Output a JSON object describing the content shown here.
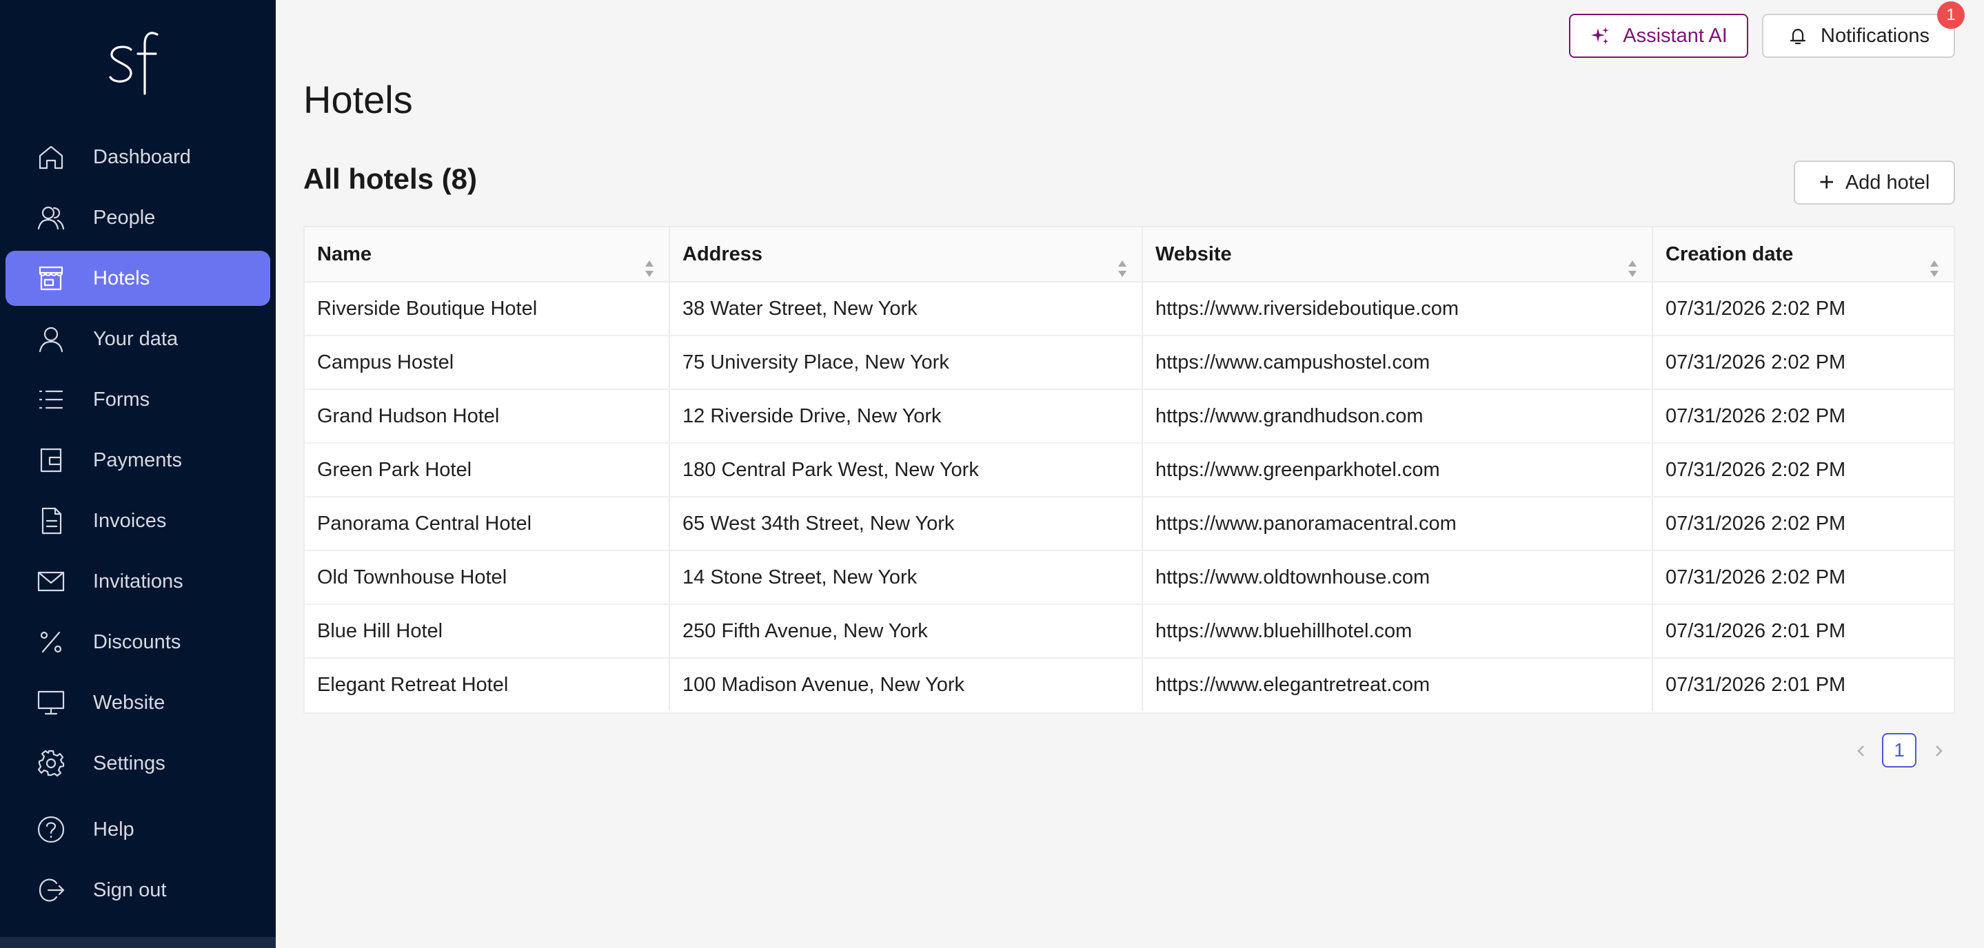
{
  "sidebar": {
    "logo_text": "sf",
    "items": [
      {
        "label": "Dashboard",
        "icon": "home-icon"
      },
      {
        "label": "People",
        "icon": "people-icon"
      },
      {
        "label": "Hotels",
        "icon": "storefront-icon",
        "active": true
      },
      {
        "label": "Your data",
        "icon": "user-icon"
      },
      {
        "label": "Forms",
        "icon": "list-icon"
      },
      {
        "label": "Payments",
        "icon": "wallet-icon"
      },
      {
        "label": "Invoices",
        "icon": "document-icon"
      },
      {
        "label": "Invitations",
        "icon": "mail-icon"
      },
      {
        "label": "Discounts",
        "icon": "percent-icon"
      },
      {
        "label": "Website",
        "icon": "monitor-icon"
      },
      {
        "label": "Settings",
        "icon": "gear-icon"
      },
      {
        "label": "Help",
        "icon": "help-icon"
      },
      {
        "label": "Sign out",
        "icon": "sign-out-icon"
      }
    ]
  },
  "header": {
    "assistant_label": "Assistant AI",
    "notifications_label": "Notifications",
    "notifications_count": "1"
  },
  "main": {
    "title": "Hotels",
    "section_title": "All hotels (8)",
    "add_label": "Add hotel",
    "table": {
      "columns": [
        "Name",
        "Address",
        "Website",
        "Creation date"
      ],
      "rows": [
        [
          "Riverside Boutique Hotel",
          "38 Water Street, New York",
          "https://www.riversideboutique.com",
          "07/31/2026 2:02 PM"
        ],
        [
          "Campus Hostel",
          "75 University Place, New York",
          "https://www.campushostel.com",
          "07/31/2026 2:02 PM"
        ],
        [
          "Grand Hudson Hotel",
          "12 Riverside Drive, New York",
          "https://www.grandhudson.com",
          "07/31/2026 2:02 PM"
        ],
        [
          "Green Park Hotel",
          "180 Central Park West, New York",
          "https://www.greenparkhotel.com",
          "07/31/2026 2:02 PM"
        ],
        [
          "Panorama Central Hotel",
          "65 West 34th Street, New York",
          "https://www.panoramacentral.com",
          "07/31/2026 2:02 PM"
        ],
        [
          "Old Townhouse Hotel",
          "14 Stone Street, New York",
          "https://www.oldtownhouse.com",
          "07/31/2026 2:02 PM"
        ],
        [
          "Blue Hill Hotel",
          "250 Fifth Avenue, New York",
          "https://www.bluehillhotel.com",
          "07/31/2026 2:01 PM"
        ],
        [
          "Elegant Retreat Hotel",
          "100 Madison Avenue, New York",
          "https://www.elegantretreat.com",
          "07/31/2026 2:01 PM"
        ]
      ]
    },
    "pagination": {
      "current_page": "1"
    }
  },
  "colors": {
    "sidebar_bg": "#03142e",
    "active_item": "#6b74f0",
    "assistant_accent": "#7b1474",
    "badge": "#ef4d4d",
    "page_accent": "#4a56d8"
  }
}
